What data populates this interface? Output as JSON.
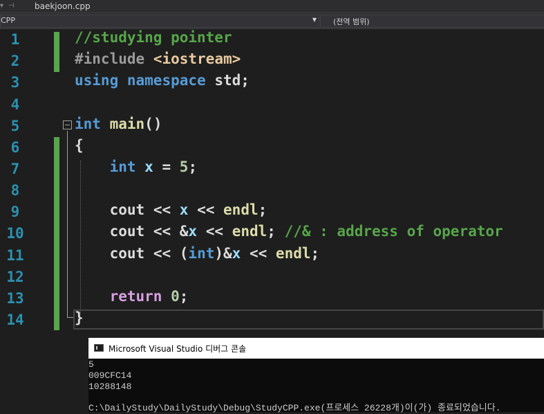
{
  "tabbar": {
    "file_tab": "baekjoon.cpp"
  },
  "navbar": {
    "project": "CPP",
    "scope": "(전역 범위)"
  },
  "editor": {
    "line_numbers": [
      "1",
      "2",
      "3",
      "4",
      "5",
      "6",
      "7",
      "8",
      "9",
      "10",
      "11",
      "12",
      "13",
      "14"
    ],
    "lines": {
      "l1": {
        "comment": "//studying pointer"
      },
      "l2": {
        "directive": "#include",
        "header": "<iostream>"
      },
      "l3": {
        "kw1": "using",
        "kw2": "namespace",
        "rest": "std;"
      },
      "l5": {
        "type": "int",
        "fn": "main",
        "paren": "()"
      },
      "l6": {
        "brace": "{"
      },
      "l7": {
        "type": "int",
        "var": "x",
        "op": "=",
        "num": "5",
        "semi": ";"
      },
      "l9": {
        "cout": "cout",
        "op1": "<<",
        "var": "x",
        "op2": "<<",
        "endl": "endl",
        "semi": ";"
      },
      "l10": {
        "cout": "cout",
        "op1": "<<",
        "amp": "&",
        "var": "x",
        "op2": "<<",
        "endl": "endl",
        "semi": ";",
        "comment": "//& : address of operator"
      },
      "l11": {
        "cout": "cout",
        "op1": "<<",
        "open": "(",
        "type": "int",
        "close": ")&",
        "var": "x",
        "op2": "<<",
        "endl": "endl",
        "semi": ";"
      },
      "l13": {
        "kw": "return",
        "num": "0",
        "semi": ";"
      },
      "l14": {
        "brace": "}"
      }
    }
  },
  "console": {
    "title": "Microsoft Visual Studio 디버그 콘솔",
    "output": [
      "5",
      "009CFC14",
      "10288148"
    ],
    "exit_message": "C:\\DailyStudy\\DailyStudy\\Debug\\StudyCPP.exe(프로세스 26228개)이(가) 종료되었습니다."
  },
  "colors": {
    "background": "#1e1e1e",
    "line_number": "#2b91af",
    "comment": "#57a64a",
    "keyword": "#569cd6",
    "control": "#d8a0df",
    "function": "#dcdcaa",
    "variable": "#9cdcfe",
    "number": "#b5cea8",
    "include_string": "#e8c9a0"
  }
}
